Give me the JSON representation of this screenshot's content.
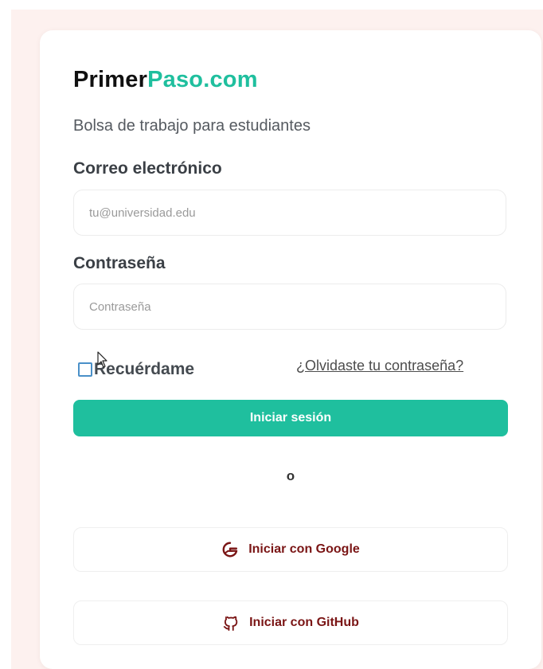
{
  "brand": {
    "part1": "Primer",
    "part2": "Paso.com"
  },
  "subtitle": "Bolsa de trabajo para estudiantes",
  "form": {
    "email_label": "Correo electrónico",
    "email_placeholder": "tu@universidad.edu",
    "email_value": "",
    "password_label": "Contraseña",
    "password_placeholder": "Contraseña",
    "password_value": "",
    "remember_label": "Recuérdame",
    "remember_checked": false,
    "forgot_label": "¿Olvidaste tu contraseña?",
    "submit_label": "Iniciar sesión"
  },
  "divider_text": "o",
  "oauth": {
    "google_label": "Iniciar con Google",
    "google_icon": "google-icon",
    "github_label": "Iniciar con GitHub",
    "github_icon": "github-icon"
  },
  "colors": {
    "accent": "#1fbf9e",
    "oauth_text": "#7a1515",
    "page_bg": "#fdf1ef"
  }
}
